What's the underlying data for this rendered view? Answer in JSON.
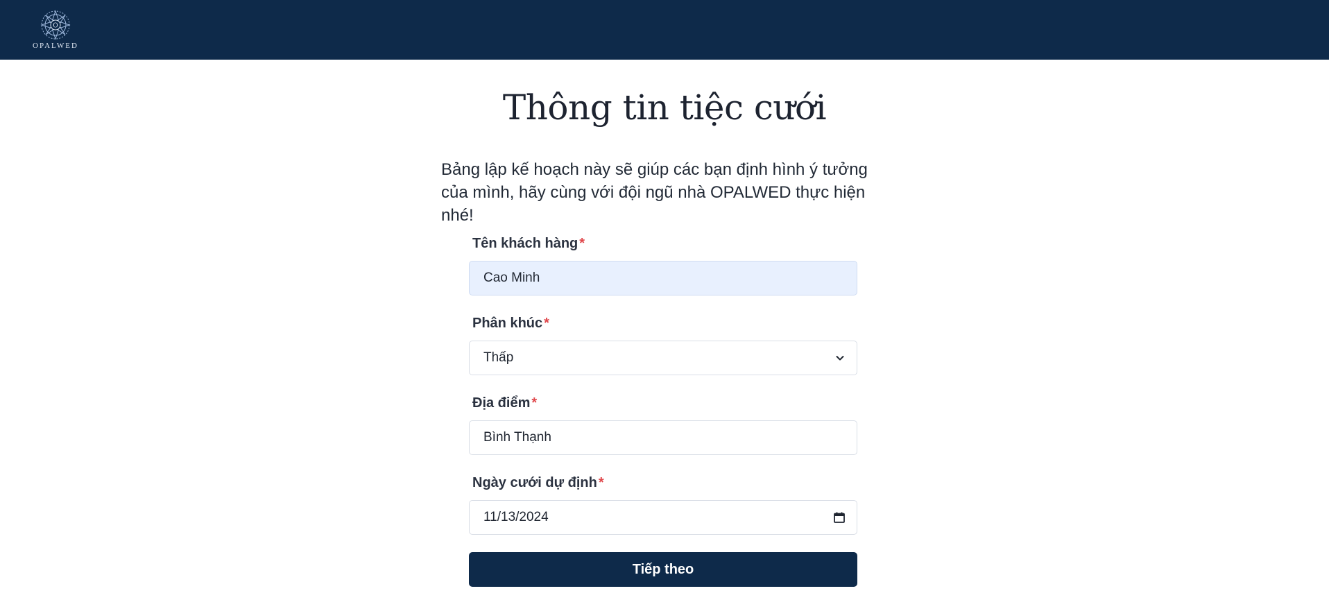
{
  "header": {
    "brand": "OPALWED"
  },
  "page": {
    "title": "Thông tin tiệc cưới",
    "intro": "Bảng lập kế hoạch này sẽ giúp các bạn định hình ý tưởng của mình, hãy cùng với đội ngũ nhà OPALWED thực hiện nhé!"
  },
  "form": {
    "required_mark": "*",
    "customer_name": {
      "label": "Tên khách hàng",
      "value": "Cao Minh"
    },
    "segment": {
      "label": "Phân khúc",
      "value": "Thấp"
    },
    "location": {
      "label": "Địa điểm",
      "value": "Bình Thạnh"
    },
    "wedding_date": {
      "label": "Ngày cưới dự định",
      "value": "11/13/2024"
    },
    "next_label": "Tiếp theo"
  },
  "icons": {
    "logo": "mandala-logo-icon",
    "select": "chevron-down-icon",
    "date": "calendar-icon"
  },
  "colors": {
    "header_bg": "#0e2a4a",
    "button_bg": "#0e2a4a",
    "required": "#e0464a",
    "autofill_bg": "#e8f0fe"
  }
}
